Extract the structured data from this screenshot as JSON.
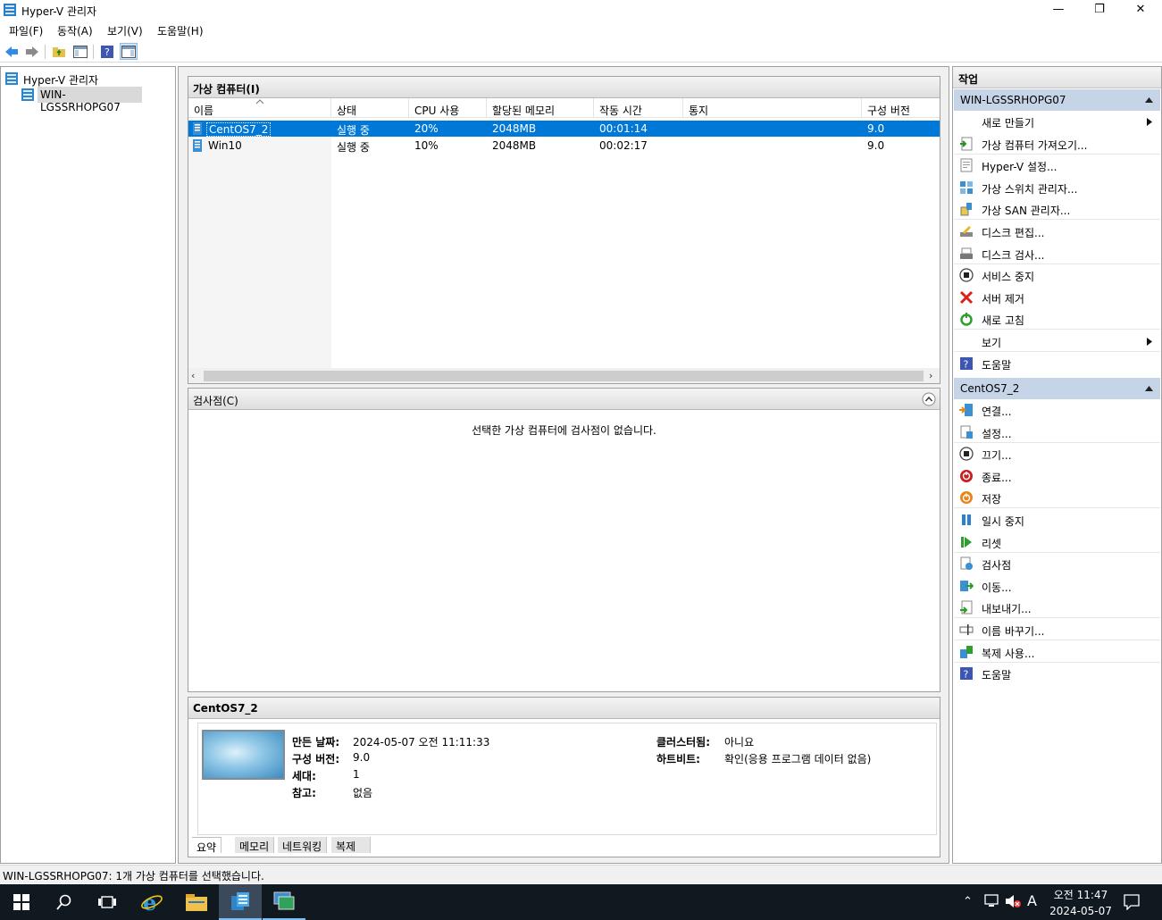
{
  "window": {
    "title": "Hyper-V 관리자",
    "minimize": "—",
    "maximize": "❐",
    "close": "✕"
  },
  "menu": [
    "파일(F)",
    "동작(A)",
    "보기(V)",
    "도움말(H)"
  ],
  "tree": {
    "root": "Hyper-V 관리자",
    "server": "WIN-LGSSRHOPG07"
  },
  "vms": {
    "title": "가상 컴퓨터(I)",
    "columns": [
      "이름",
      "상태",
      "CPU 사용",
      "할당된 메모리",
      "작동 시간",
      "통지",
      "구성 버전"
    ],
    "rows": [
      {
        "name": "CentOS7_2",
        "state": "실행 중",
        "cpu": "20%",
        "memory": "2048MB",
        "uptime": "00:01:14",
        "notice": "",
        "version": "9.0"
      },
      {
        "name": "Win10",
        "state": "실행 중",
        "cpu": "10%",
        "memory": "2048MB",
        "uptime": "00:02:17",
        "notice": "",
        "version": "9.0"
      }
    ]
  },
  "checkpoints": {
    "title": "검사점(C)",
    "empty": "선택한 가상 컴퓨터에 검사점이 없습니다."
  },
  "details": {
    "title": "CentOS7_2",
    "created_label": "만든 날짜:",
    "created_value": "2024-05-07 오전 11:11:33",
    "version_label": "구성 버전:",
    "version_value": "9.0",
    "generation_label": "세대:",
    "generation_value": "1",
    "notes_label": "참고:",
    "notes_value": "없음",
    "cluster_label": "클러스터됨:",
    "cluster_value": "아니요",
    "heartbeat_label": "하트비트:",
    "heartbeat_value": "확인(응용 프로그램 데이터 없음)",
    "tabs": [
      "요약",
      "메모리",
      "네트워킹",
      "복제"
    ]
  },
  "actions": {
    "title": "작업",
    "server_header": "WIN-LGSSRHOPG07",
    "server_items": [
      {
        "label": "새로 만들기",
        "icon": "none",
        "arrow": true
      },
      {
        "label": "가상 컴퓨터 가져오기...",
        "icon": "import-icon"
      },
      {
        "label": "Hyper-V 설정...",
        "icon": "settings-page-icon"
      },
      {
        "label": "가상 스위치 관리자...",
        "icon": "switch-icon"
      },
      {
        "label": "가상 SAN 관리자...",
        "icon": "san-icon"
      },
      {
        "label": "디스크 편집...",
        "icon": "disk-edit-icon"
      },
      {
        "label": "디스크 검사...",
        "icon": "disk-inspect-icon"
      },
      {
        "label": "서비스 중지",
        "icon": "stop-icon"
      },
      {
        "label": "서버 제거",
        "icon": "remove-icon"
      },
      {
        "label": "새로 고침",
        "icon": "refresh-icon"
      },
      {
        "label": "보기",
        "icon": "none",
        "arrow": true
      },
      {
        "label": "도움말",
        "icon": "help-icon"
      }
    ],
    "vm_header": "CentOS7_2",
    "vm_items": [
      {
        "label": "연결...",
        "icon": "connect-icon"
      },
      {
        "label": "설정...",
        "icon": "settings-icon"
      },
      {
        "label": "끄기...",
        "icon": "turn-off-icon"
      },
      {
        "label": "종료...",
        "icon": "shutdown-icon"
      },
      {
        "label": "저장",
        "icon": "save-icon"
      },
      {
        "label": "일시 중지",
        "icon": "pause-icon"
      },
      {
        "label": "리셋",
        "icon": "reset-icon"
      },
      {
        "label": "검사점",
        "icon": "checkpoint-icon"
      },
      {
        "label": "이동...",
        "icon": "move-icon"
      },
      {
        "label": "내보내기...",
        "icon": "export-icon"
      },
      {
        "label": "이름 바꾸기...",
        "icon": "rename-icon"
      },
      {
        "label": "복제 사용...",
        "icon": "replication-icon"
      },
      {
        "label": "도움말",
        "icon": "help-icon"
      }
    ]
  },
  "status": "WIN-LGSSRHOPG07:  1개 가상 컴퓨터를 선택했습니다.",
  "tray": {
    "ime": "A",
    "time": "오전 11:47",
    "date": "2024-05-07"
  }
}
